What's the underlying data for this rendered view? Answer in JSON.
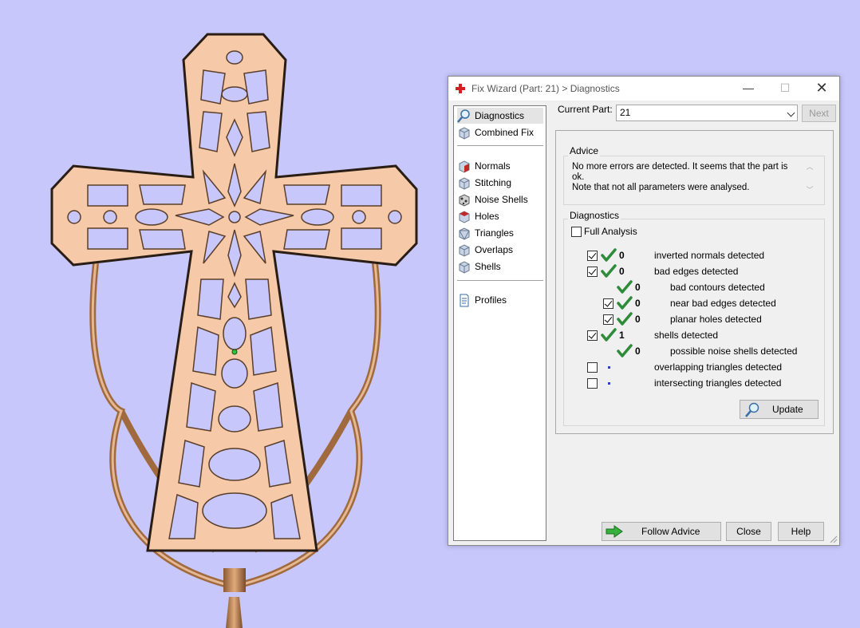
{
  "window": {
    "title": "Fix Wizard (Part: 21) > Diagnostics",
    "minimize_label": "—",
    "maximize_label": "☐",
    "close_label": "✕"
  },
  "sidebar": {
    "items": [
      {
        "label": "Diagnostics",
        "icon": "magnifier-icon",
        "active": true
      },
      {
        "label": "Combined Fix",
        "icon": "cube-icon"
      },
      {
        "label": "Normals",
        "icon": "normals-cube-icon"
      },
      {
        "label": "Stitching",
        "icon": "stitching-cube-icon"
      },
      {
        "label": "Noise Shells",
        "icon": "noise-shells-icon"
      },
      {
        "label": "Holes",
        "icon": "holes-cube-icon"
      },
      {
        "label": "Triangles",
        "icon": "triangles-cube-icon"
      },
      {
        "label": "Overlaps",
        "icon": "overlaps-cube-icon"
      },
      {
        "label": "Shells",
        "icon": "shells-cube-icon"
      },
      {
        "label": "Profiles",
        "icon": "document-icon"
      }
    ]
  },
  "current_part": {
    "label": "Current Part:",
    "value": "21",
    "next_label": "Next"
  },
  "advice": {
    "title": "Advice",
    "line1": "No more errors are detected. It seems that the part is ok.",
    "line2": "Note that not all parameters were analysed."
  },
  "diagnostics": {
    "title": "Diagnostics",
    "full_analysis_label": "Full Analysis",
    "rows": [
      {
        "label": "inverted normals detected",
        "count": "0",
        "checked": true,
        "status": "ok"
      },
      {
        "label": "bad edges detected",
        "count": "0",
        "checked": true,
        "status": "ok"
      },
      {
        "label": "bad contours detected",
        "count": "0",
        "status": "ok"
      },
      {
        "label": "near bad edges detected",
        "count": "0",
        "checked": true,
        "status": "ok"
      },
      {
        "label": "planar holes detected",
        "count": "0",
        "checked": true,
        "status": "ok"
      },
      {
        "label": "shells detected",
        "count": "1",
        "checked": true,
        "status": "ok"
      },
      {
        "label": "possible noise shells detected",
        "count": "0",
        "status": "ok"
      },
      {
        "label": "overlapping triangles detected",
        "checked": false,
        "status": "unchecked"
      },
      {
        "label": "intersecting triangles detected",
        "checked": false,
        "status": "unchecked"
      }
    ],
    "update_label": "Update"
  },
  "buttons": {
    "follow_advice": "Follow Advice",
    "close": "Close",
    "help": "Help"
  },
  "colors": {
    "background": "#c7c7fb",
    "part_fill": "#f6c9a8",
    "check_green": "#2e8b3a"
  }
}
